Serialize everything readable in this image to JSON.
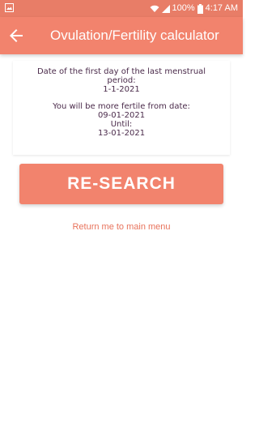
{
  "status_bar": {
    "battery_percent": "100%",
    "time": "4:17 AM",
    "icons": [
      "image-icon",
      "wifi-icon",
      "signal-icon",
      "battery-icon"
    ]
  },
  "app_bar": {
    "title": "Ovulation/Fertility calculator",
    "back_icon": "arrow-back-icon",
    "color": "#f2836d"
  },
  "result": {
    "period_label_line1": "Date of the first day of the last menstrual",
    "period_label_line2": "period:",
    "period_date": "1-1-2021",
    "fertile_label": "You will be more fertile from date:",
    "fertile_start": "09-01-2021",
    "until_label": "Until:",
    "fertile_end": "13-01-2021"
  },
  "actions": {
    "research_label": "RE-SEARCH",
    "main_menu_label": "Return me to main menu"
  },
  "colors": {
    "accent": "#f2836d",
    "status_bar": "#e87d67",
    "result_text": "#4a2a4a",
    "link": "#e8735c"
  }
}
